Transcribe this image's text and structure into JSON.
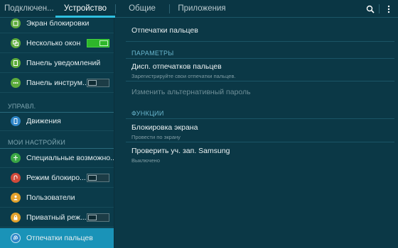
{
  "tabs": [
    {
      "label": "Подключен..."
    },
    {
      "label": "Устройство"
    },
    {
      "label": "Общие"
    },
    {
      "label": "Приложения"
    }
  ],
  "sidebar": {
    "items": [
      {
        "label": "Экран блокировки",
        "icon": "lock-screen-icon",
        "color": "#5cab3c"
      },
      {
        "label": "Несколько окон",
        "icon": "multi-window-icon",
        "color": "#5cab3c",
        "toggle": "on"
      },
      {
        "label": "Панель уведомлений",
        "icon": "notification-panel-icon",
        "color": "#5cab3c"
      },
      {
        "label": "Панель инструм...",
        "icon": "toolbox-icon",
        "color": "#5cab3c",
        "toggle": "off"
      },
      {
        "label": "Движения",
        "icon": "motion-icon",
        "color": "#2f86c8"
      },
      {
        "label": "Специальные возможно...",
        "icon": "accessibility-icon",
        "color": "#3aa644"
      },
      {
        "label": "Режим блокиро...",
        "icon": "blocking-mode-icon",
        "color": "#d04a3a",
        "toggle": "off"
      },
      {
        "label": "Пользователи",
        "icon": "users-icon",
        "color": "#e2a12c"
      },
      {
        "label": "Приватный реж...",
        "icon": "private-mode-icon",
        "color": "#e2a12c",
        "toggle": "off"
      },
      {
        "label": "Отпечатки пальцев",
        "icon": "fingerprint-icon",
        "color": "#2f86c8"
      }
    ],
    "sections": [
      {
        "label": "УПРАВЛ."
      },
      {
        "label": "МОИ НАСТРОЙКИ"
      }
    ]
  },
  "content": {
    "title": "Отпечатки пальцев",
    "sections": [
      {
        "label": "ПАРАМЕТРЫ"
      },
      {
        "label": "ФУНКЦИИ"
      }
    ],
    "items": [
      {
        "title": "Дисп. отпечатков пальцев",
        "subtitle": "Зарегистрируйте свои отпечатки пальцев."
      },
      {
        "title": "Изменить альтернативный пароль"
      },
      {
        "title": "Блокировка экрана",
        "subtitle": "Провести по экрану"
      },
      {
        "title": "Проверить уч. зап. Samsung",
        "subtitle": "Выключено"
      }
    ]
  },
  "colors": {
    "background": "#0b3846",
    "accent": "#2fc0e0",
    "selected": "#1a93b8",
    "toggle_on": "#2eb62a"
  }
}
